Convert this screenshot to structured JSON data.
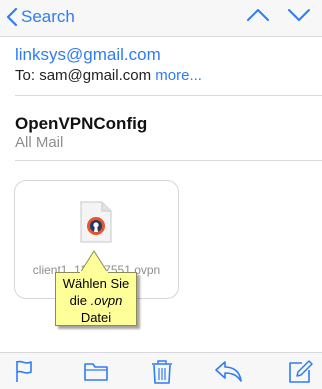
{
  "nav": {
    "back_label": "Search"
  },
  "header": {
    "from": "linksys@gmail.com",
    "to_prefix": "To: ",
    "to_address": "sam@gmail.com",
    "more_label": "more..."
  },
  "message": {
    "subject": "OpenVPNConfig",
    "folder": "All Mail"
  },
  "attachment": {
    "file_name": "client1_138...7551.ovpn"
  },
  "callout": {
    "line1": "Wählen Sie",
    "line2_prefix": "die ",
    "line2_italic": ".ovpn",
    "line3": "Datei"
  },
  "colors": {
    "accent": "#2f7cf6",
    "callout_bg": "#ffff9a",
    "ovpn_orange": "#e8542b"
  },
  "toolbar_icons": [
    "flag-icon",
    "folder-icon",
    "trash-icon",
    "reply-icon",
    "compose-icon"
  ]
}
